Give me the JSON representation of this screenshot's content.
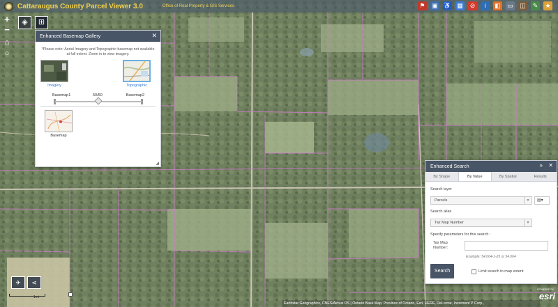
{
  "header": {
    "title": "Cattaraugus County Parcel Viewer 3.0",
    "subtitle": "Office of Real Property & GIS Services",
    "tools": [
      {
        "icon": "flag-icon",
        "color": "#c0392b"
      },
      {
        "icon": "bus-icon",
        "color": "#3d6fb0"
      },
      {
        "icon": "wheelchair-icon",
        "color": "#2d5fa8"
      },
      {
        "icon": "table-icon",
        "color": "#3a7bd5"
      },
      {
        "icon": "stop-icon",
        "color": "#d23b2f"
      },
      {
        "icon": "info-icon",
        "color": "#2f6db5"
      },
      {
        "icon": "measure-icon",
        "color": "#e0712a"
      },
      {
        "icon": "print-icon",
        "color": "#6a7a8a"
      },
      {
        "icon": "layers-list-icon",
        "color": "#7b5c3a"
      },
      {
        "icon": "draw-icon",
        "color": "#4a8a4a"
      },
      {
        "icon": "bookmark-icon",
        "color": "#d9a23a"
      }
    ]
  },
  "controls": {
    "zoom_in": "+",
    "zoom_out": "−"
  },
  "gallery": {
    "title": "Enhanced Basemap Gallery",
    "note": "*Please note: Aerial Imagery and Topographic basemap not available at full extent. Zoom in to view imagery.",
    "items": [
      {
        "label": "Imagery",
        "selected": false
      },
      {
        "label": "Topographic",
        "selected": true
      },
      {
        "label": "Basemap",
        "selected": false
      }
    ],
    "slider": {
      "left_label": "Basemap1",
      "right_label": "Basemap2",
      "value_label": "50/50",
      "value": 0.5
    }
  },
  "search": {
    "title": "Enhanced Search",
    "tabs": [
      "By Shape",
      "By Value",
      "By Spatial",
      "Results"
    ],
    "active_tab": 1,
    "layer_label": "Search layer",
    "layer_value": "Parcels",
    "alias_label": "Search alias",
    "alias_value": "Tax Map Number",
    "params_label": "Specify parameters for this search :",
    "field_label": "Tax Map Number:",
    "field_value": "",
    "example": "Example: 54.064-1-25 or 54.064",
    "button": "Search",
    "limit_label": "Limit search to map extent",
    "limit_checked": false
  },
  "scale": {
    "label": "1mi"
  },
  "attribution": "Earthstar Geographics, CNES/Airbus DS | Ontario Base Map, Province of Ontario, Esri, HERE, DeLorme, Increment P Corp.,",
  "esri": {
    "logo": "esri",
    "powered": "POWERED BY"
  }
}
